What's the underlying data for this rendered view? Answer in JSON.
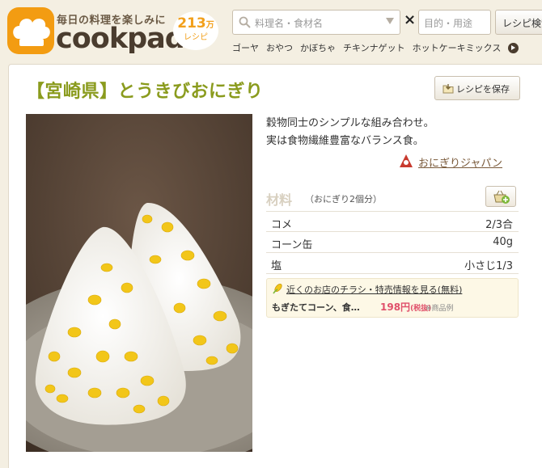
{
  "header": {
    "tagline": "毎日の料理を楽しみに",
    "logo_word": "cookpad",
    "recipe_count_num": "213",
    "recipe_count_suffix": "万",
    "recipe_count_unit": "レシピ",
    "search_placeholder": "料理名・食材名",
    "times_symbol": "×",
    "purpose_placeholder": "目的・用途",
    "search_button": "レシピ検索",
    "keywords": [
      "ゴーヤ",
      "おやつ",
      "かぼちゃ",
      "チキンナゲット",
      "ホットケーキミックス"
    ]
  },
  "recipe": {
    "title": "【宮崎県】とうきびおにぎり",
    "save_button": "レシピを保存",
    "description_lines": [
      "穀物同士のシンプルな組み合わせ。",
      "実は食物繊維豊富なバランス食。"
    ],
    "author": "おにぎりジャパン"
  },
  "ingredients": {
    "heading": "材料",
    "servings": "（おにぎり2個分）",
    "items": [
      {
        "name": "コメ",
        "qty": "2/3合"
      },
      {
        "name": "コーン缶",
        "qty": "40g"
      },
      {
        "name": "塩",
        "qty": "小さじ1/3"
      }
    ]
  },
  "ad": {
    "link_text": "近くのお店のチラシ・特売情報を見る(無料)",
    "product": "もぎたてコーン、食…",
    "price": "198円",
    "tax": "(税抜)",
    "note": "※商品例"
  },
  "colors": {
    "brand_orange": "#f2a01c",
    "title_green": "#8a9b1d",
    "price_pink": "#e0506a",
    "page_bg": "#f4efe2"
  }
}
